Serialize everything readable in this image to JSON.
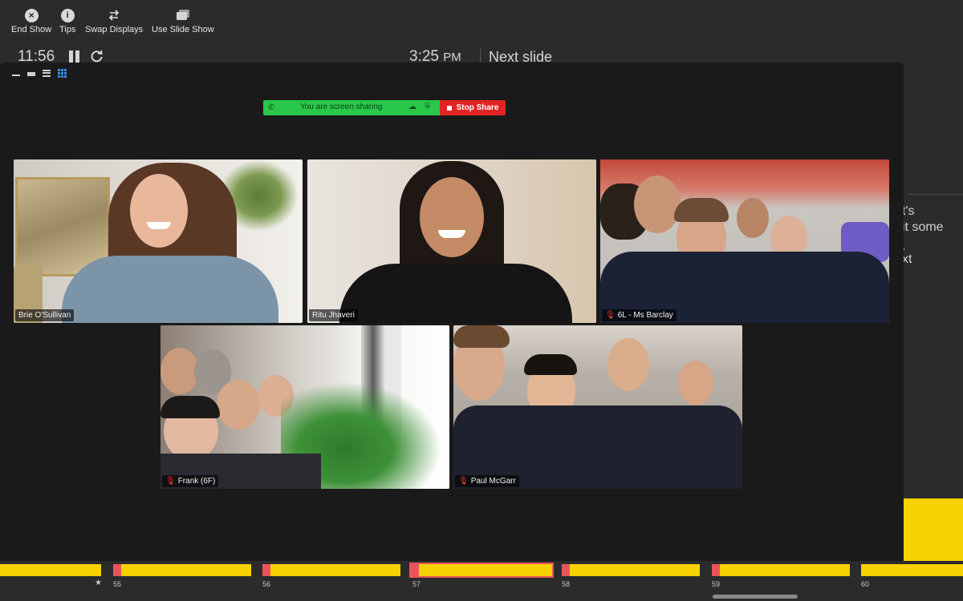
{
  "toolbar": {
    "end_show": "End Show",
    "tips": "Tips",
    "swap_displays": "Swap Displays",
    "use_slide_show": "Use Slide Show"
  },
  "timer": {
    "elapsed": "11:56",
    "clock_time": "3:25",
    "clock_ampm": "PM",
    "next_slide": "Next slide"
  },
  "notes": {
    "line1": "t's",
    "line2": "it some",
    "line3": ".",
    "line4": "xt"
  },
  "zoom": {
    "share_status": "You are screen sharing",
    "stop_share": "Stop Share",
    "accent_green": "#27c54a",
    "stop_red": "#e02424",
    "participants": [
      {
        "name": "Brie O'Sullivan",
        "muted": false,
        "active": false
      },
      {
        "name": "Ritu Jhaveri",
        "muted": false,
        "active": true
      },
      {
        "name": "6L - Ms Barclay",
        "muted": true,
        "active": false
      },
      {
        "name": "Frank (6F)",
        "muted": true,
        "active": false
      },
      {
        "name": "Paul McGarr",
        "muted": true,
        "active": false
      }
    ]
  },
  "filmstrip": {
    "slide_numbers": [
      "55",
      "56",
      "57",
      "58",
      "59",
      "60"
    ],
    "star_mark": "★",
    "slide_color": "#f7d100",
    "current_slide": "57"
  }
}
